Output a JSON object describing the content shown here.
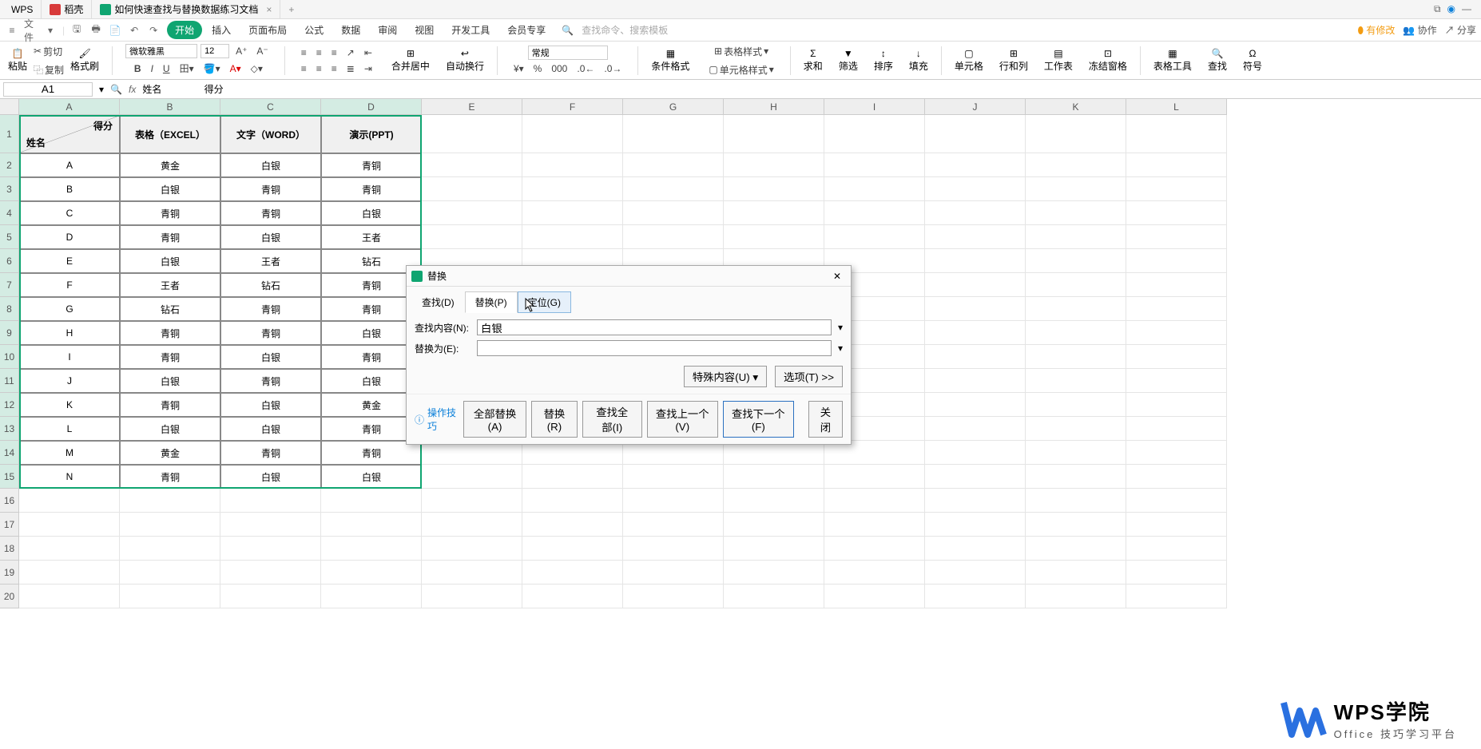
{
  "title_bar": {
    "tabs": [
      {
        "label": "WPS"
      },
      {
        "label": "稻壳"
      },
      {
        "label": "如何快速查找与替换数据练习文档"
      }
    ],
    "right_icons": [
      "num-1-icon",
      "wps-sync-icon",
      "minimize-icon"
    ]
  },
  "menu_bar": {
    "file": "文件",
    "items": [
      "开始",
      "插入",
      "页面布局",
      "公式",
      "数据",
      "审阅",
      "视图",
      "开发工具",
      "会员专享"
    ],
    "active_index": 0,
    "search_hint": "查找命令、搜索模板",
    "right": {
      "changes": "有修改",
      "collab": "协作",
      "share": "分享"
    }
  },
  "ribbon": {
    "paste": "粘贴",
    "cut": "剪切",
    "copy": "复制",
    "format_painter": "格式刷",
    "font_name": "微软雅黑",
    "font_size": "12",
    "merge": "合并居中",
    "wrap": "自动换行",
    "number_format": "常规",
    "cond_format": "条件格式",
    "table_style": "表格样式",
    "cell_style": "单元格样式",
    "sum": "求和",
    "filter": "筛选",
    "sort": "排序",
    "fill": "填充",
    "cells": "单元格",
    "rowcol": "行和列",
    "worksheet": "工作表",
    "freeze": "冻结窗格",
    "table_tools": "表格工具",
    "find": "查找",
    "symbol": "符号"
  },
  "formula_bar": {
    "name_box": "A1",
    "formula_content": "姓名                得分"
  },
  "columns": [
    "A",
    "B",
    "C",
    "D",
    "E",
    "F",
    "G",
    "H",
    "I",
    "J",
    "K",
    "L"
  ],
  "header_row": {
    "diag_top": "得分",
    "diag_bottom": "姓名",
    "b": "表格（EXCEL）",
    "c": "文字（WORD）",
    "d": "演示(PPT)"
  },
  "table_rows": [
    [
      "A",
      "黄金",
      "白银",
      "青铜"
    ],
    [
      "B",
      "白银",
      "青铜",
      "青铜"
    ],
    [
      "C",
      "青铜",
      "青铜",
      "白银"
    ],
    [
      "D",
      "青铜",
      "白银",
      "王者"
    ],
    [
      "E",
      "白银",
      "王者",
      "钻石"
    ],
    [
      "F",
      "王者",
      "钻石",
      "青铜"
    ],
    [
      "G",
      "钻石",
      "青铜",
      "青铜"
    ],
    [
      "H",
      "青铜",
      "青铜",
      "白银"
    ],
    [
      "I",
      "青铜",
      "白银",
      "青铜"
    ],
    [
      "J",
      "白银",
      "青铜",
      "白银"
    ],
    [
      "K",
      "青铜",
      "白银",
      "黄金"
    ],
    [
      "L",
      "白银",
      "白银",
      "青铜"
    ],
    [
      "M",
      "黄金",
      "青铜",
      "青铜"
    ],
    [
      "N",
      "青铜",
      "白银",
      "白银"
    ]
  ],
  "dialog": {
    "title": "替换",
    "tabs": {
      "find": "查找(D)",
      "replace": "替换(P)",
      "goto": "定位(G)"
    },
    "find_label": "查找内容(N):",
    "find_value": "白银",
    "replace_label": "替换为(E):",
    "replace_value": "",
    "special": "特殊内容(U)",
    "options": "选项(T) >>",
    "tips": "操作技巧",
    "btn_replace_all": "全部替换(A)",
    "btn_replace": "替换(R)",
    "btn_find_all": "查找全部(I)",
    "btn_find_prev": "查找上一个(V)",
    "btn_find_next": "查找下一个(F)",
    "btn_close": "关闭"
  },
  "watermark": {
    "title": "WPS学院",
    "subtitle": "Office 技巧学习平台"
  }
}
